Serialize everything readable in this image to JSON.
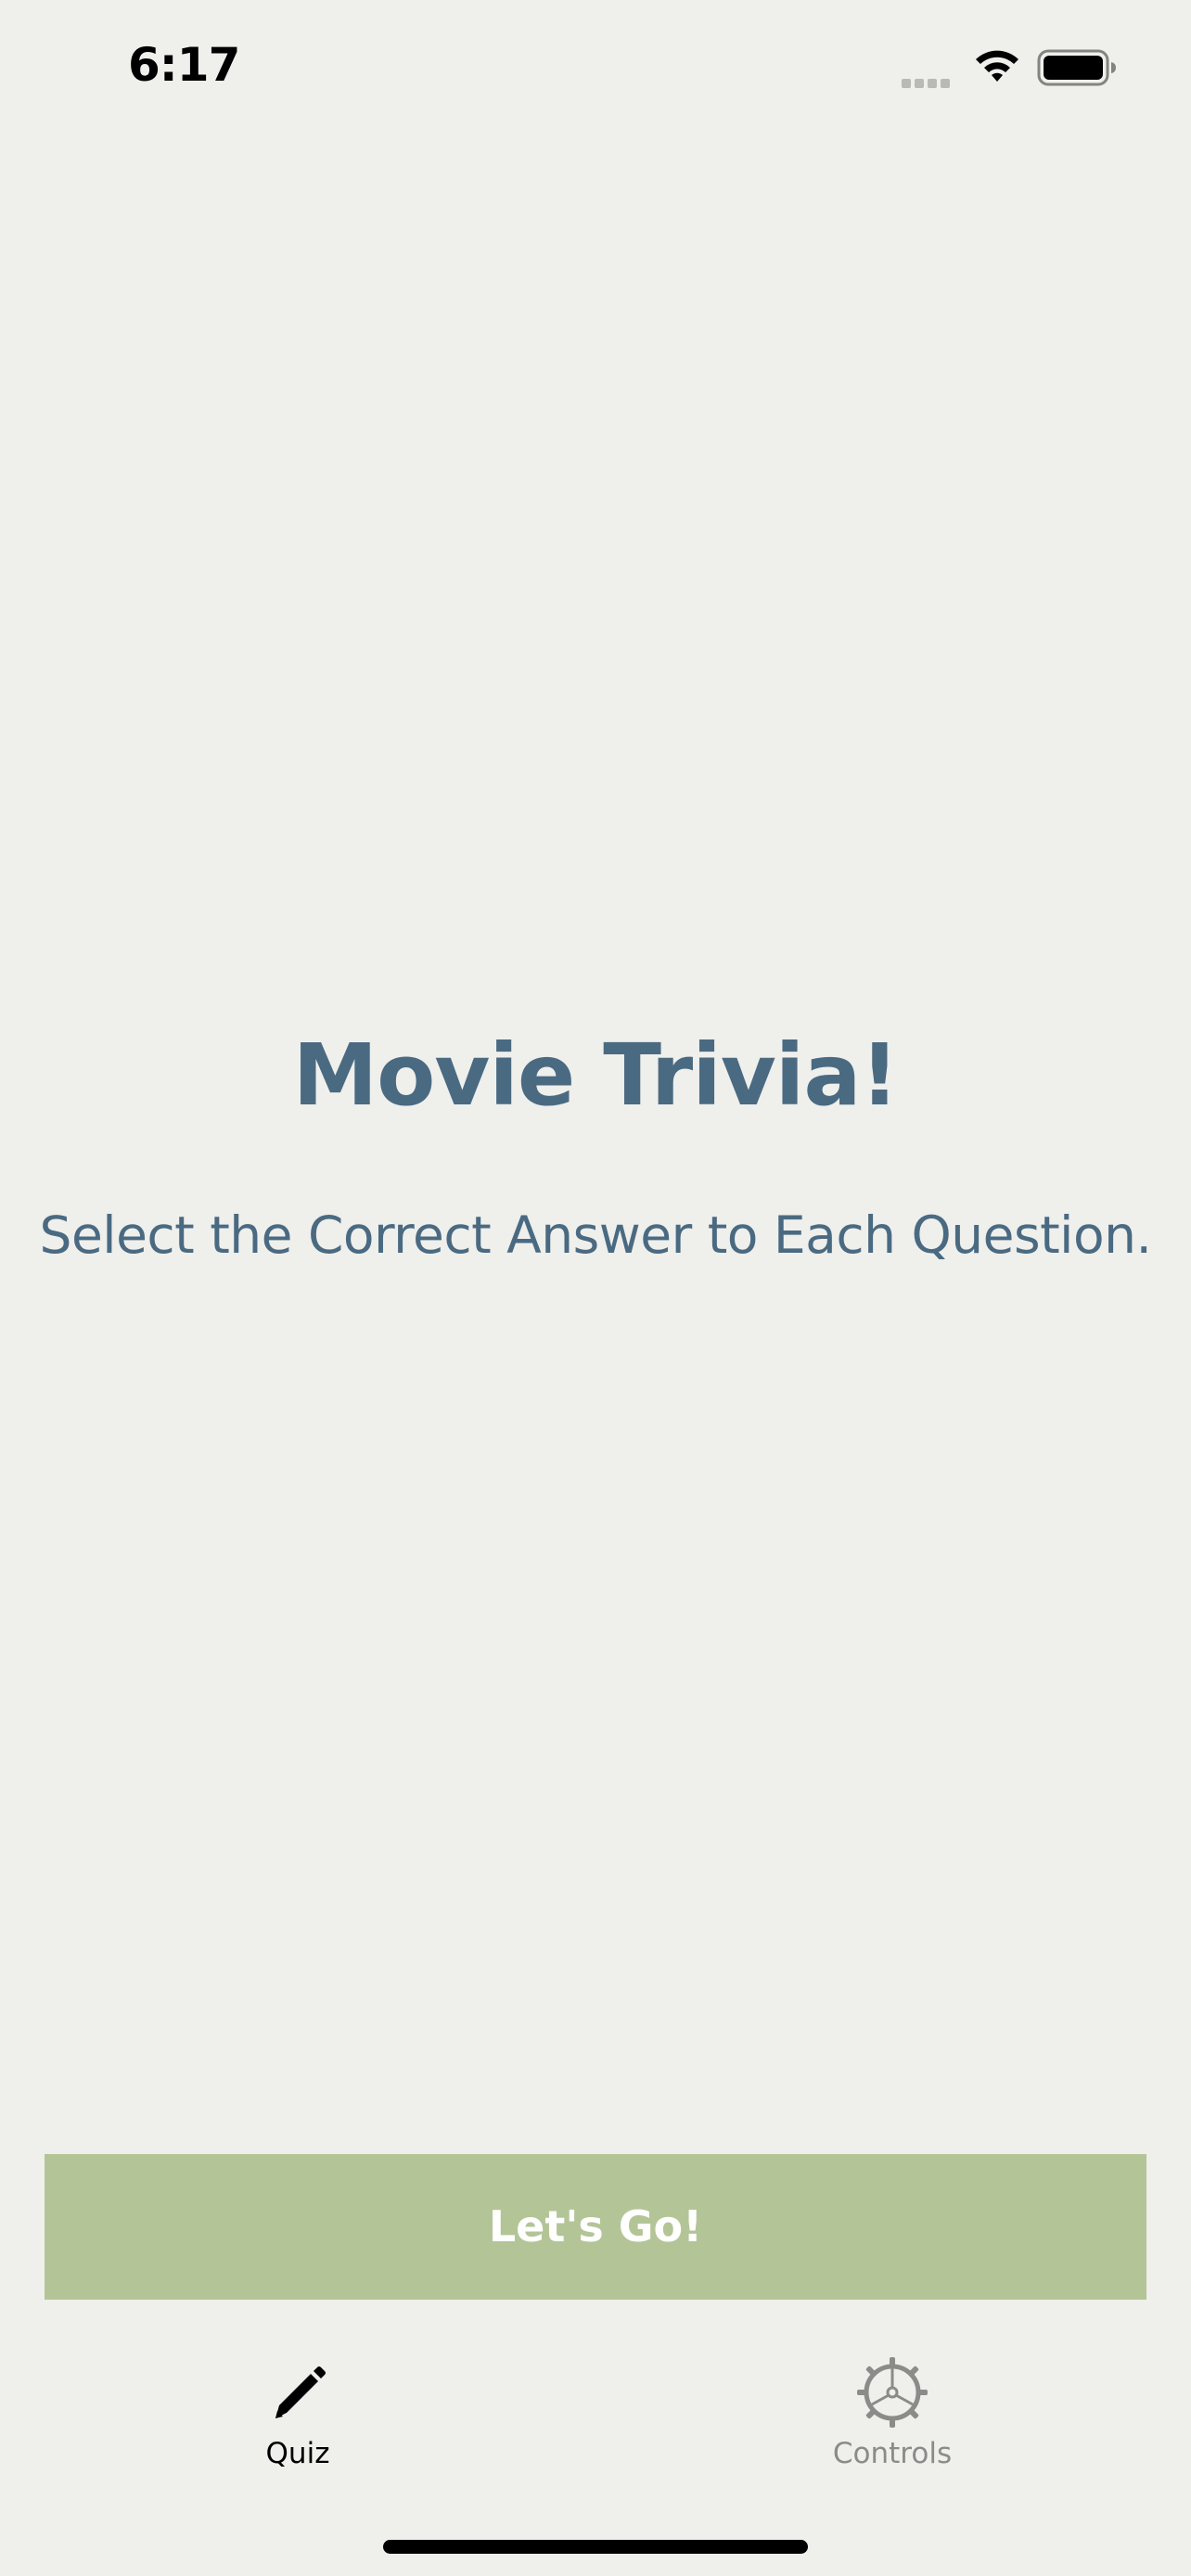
{
  "status_bar": {
    "time": "6:17",
    "icons": [
      "signal-dots-icon",
      "wifi-icon",
      "battery-icon"
    ]
  },
  "main": {
    "title": "Movie Trivia!",
    "subtitle": "Select the Correct Answer to Each Question."
  },
  "action": {
    "go_label": "Let's Go!"
  },
  "tab_bar": {
    "tabs": [
      {
        "label": "Quiz",
        "icon": "pencil-icon",
        "selected": true
      },
      {
        "label": "Controls",
        "icon": "gear-icon",
        "selected": false
      }
    ]
  },
  "colors": {
    "background": "#efefec",
    "text_accent": "#4a6a82",
    "button": "#b3c596",
    "button_text": "#ffffff",
    "tab_inactive": "#8b8b89"
  }
}
